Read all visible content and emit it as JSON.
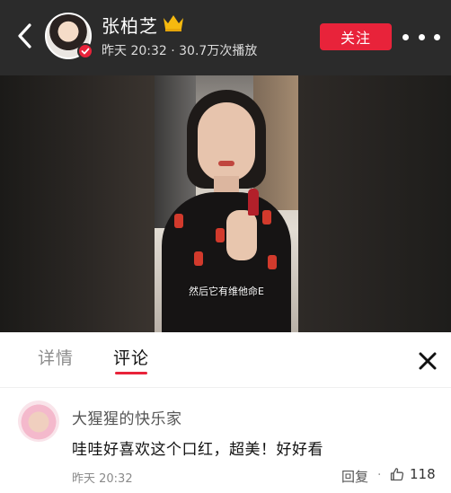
{
  "header": {
    "user_name": "张柏芝",
    "meta": "昨天 20:32 · 30.7万次播放",
    "follow_label": "关注",
    "icons": {
      "back": "chevron-left-icon",
      "crown": "crown-icon",
      "verified": "verified-badge-icon",
      "more": "more-icon"
    }
  },
  "video": {
    "subtitle": "然后它有维他命E"
  },
  "tabs": [
    {
      "label": "详情",
      "active": false
    },
    {
      "label": "评论",
      "active": true
    }
  ],
  "comment": {
    "author": "大猩猩的快乐家",
    "text": "哇哇好喜欢这个口红，超美！好好看",
    "time": "昨天 20:32",
    "reply_label": "回复",
    "separator": "·",
    "like_count": "118"
  },
  "colors": {
    "accent": "#e8233a",
    "header_bg": "#2b2b2b"
  }
}
